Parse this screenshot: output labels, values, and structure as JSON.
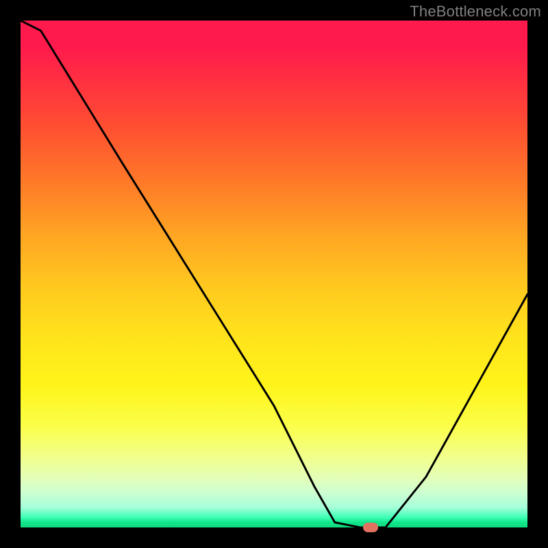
{
  "watermark": "TheBottleneck.com",
  "chart_data": {
    "type": "line",
    "title": "",
    "xlabel": "",
    "ylabel": "",
    "xlim": [
      0,
      100
    ],
    "ylim": [
      0,
      100
    ],
    "x": [
      0,
      4,
      20,
      30,
      40,
      50,
      58,
      62,
      67,
      72,
      80,
      90,
      100
    ],
    "values": [
      100,
      98,
      72,
      56,
      40,
      24,
      8,
      1,
      0,
      0,
      10,
      28,
      46
    ],
    "marker": {
      "x": 69,
      "y": 0
    },
    "gradient_stops": [
      {
        "pos": 0,
        "color": "#ff1a4d"
      },
      {
        "pos": 50,
        "color": "#ffc71f"
      },
      {
        "pos": 80,
        "color": "#fbff4a"
      },
      {
        "pos": 100,
        "color": "#0fd97f"
      }
    ]
  }
}
